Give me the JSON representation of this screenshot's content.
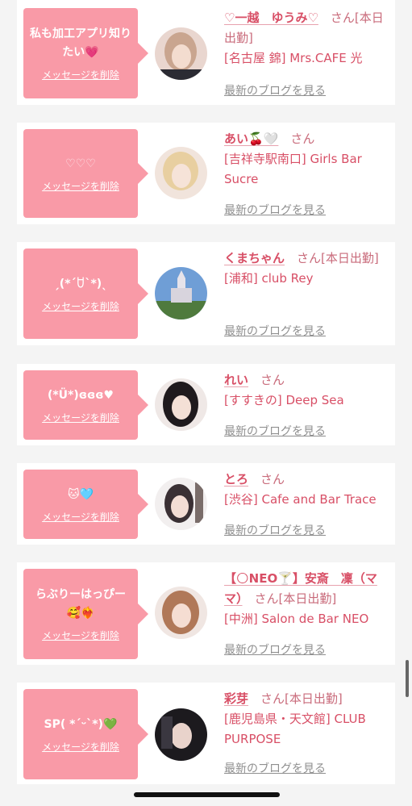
{
  "delete_label": "メッセージを削除",
  "blog_label": "最新のブログを見る",
  "san": "さん",
  "cards": [
    {
      "message": "私も加工アプリ知りたい💗",
      "name": "♡一越　ゆうみ♡",
      "suffix": "さん[本日出勤]",
      "store": "[名古屋 錦] Mrs.CAFE 光"
    },
    {
      "message": "♡♡♡",
      "name": "あい🍒🤍",
      "suffix": "さん",
      "store": "[吉祥寺駅南口] Girls Bar Sucre"
    },
    {
      "message": "ˏ(*´ꇴ`*)ˎ",
      "name": "くまちゃん",
      "suffix": "さん[本日出勤]",
      "store": "[浦和] club Rey"
    },
    {
      "message": "(*Ü*)ɞɞɞ♥",
      "name": "れい",
      "suffix": "さん",
      "store": "[すすきの] Deep Sea"
    },
    {
      "message": "🐱🩵",
      "name": "とろ",
      "suffix": "さん",
      "store": "[渋谷] Cafe and Bar Trace"
    },
    {
      "message": "らぶりーはっぴー🥰❤️‍🔥",
      "name": "【🌕NEO🍸】安斎　凜（ママ）",
      "suffix": "さん[本日出勤]",
      "store": "[中洲] Salon de Bar NEO"
    },
    {
      "message": "SP( *´ᵕ`*)💚",
      "name": "彩芽",
      "suffix": "さん[本日出勤]",
      "store": "[鹿児島県・天文館] CLUB PURPOSE"
    }
  ]
}
